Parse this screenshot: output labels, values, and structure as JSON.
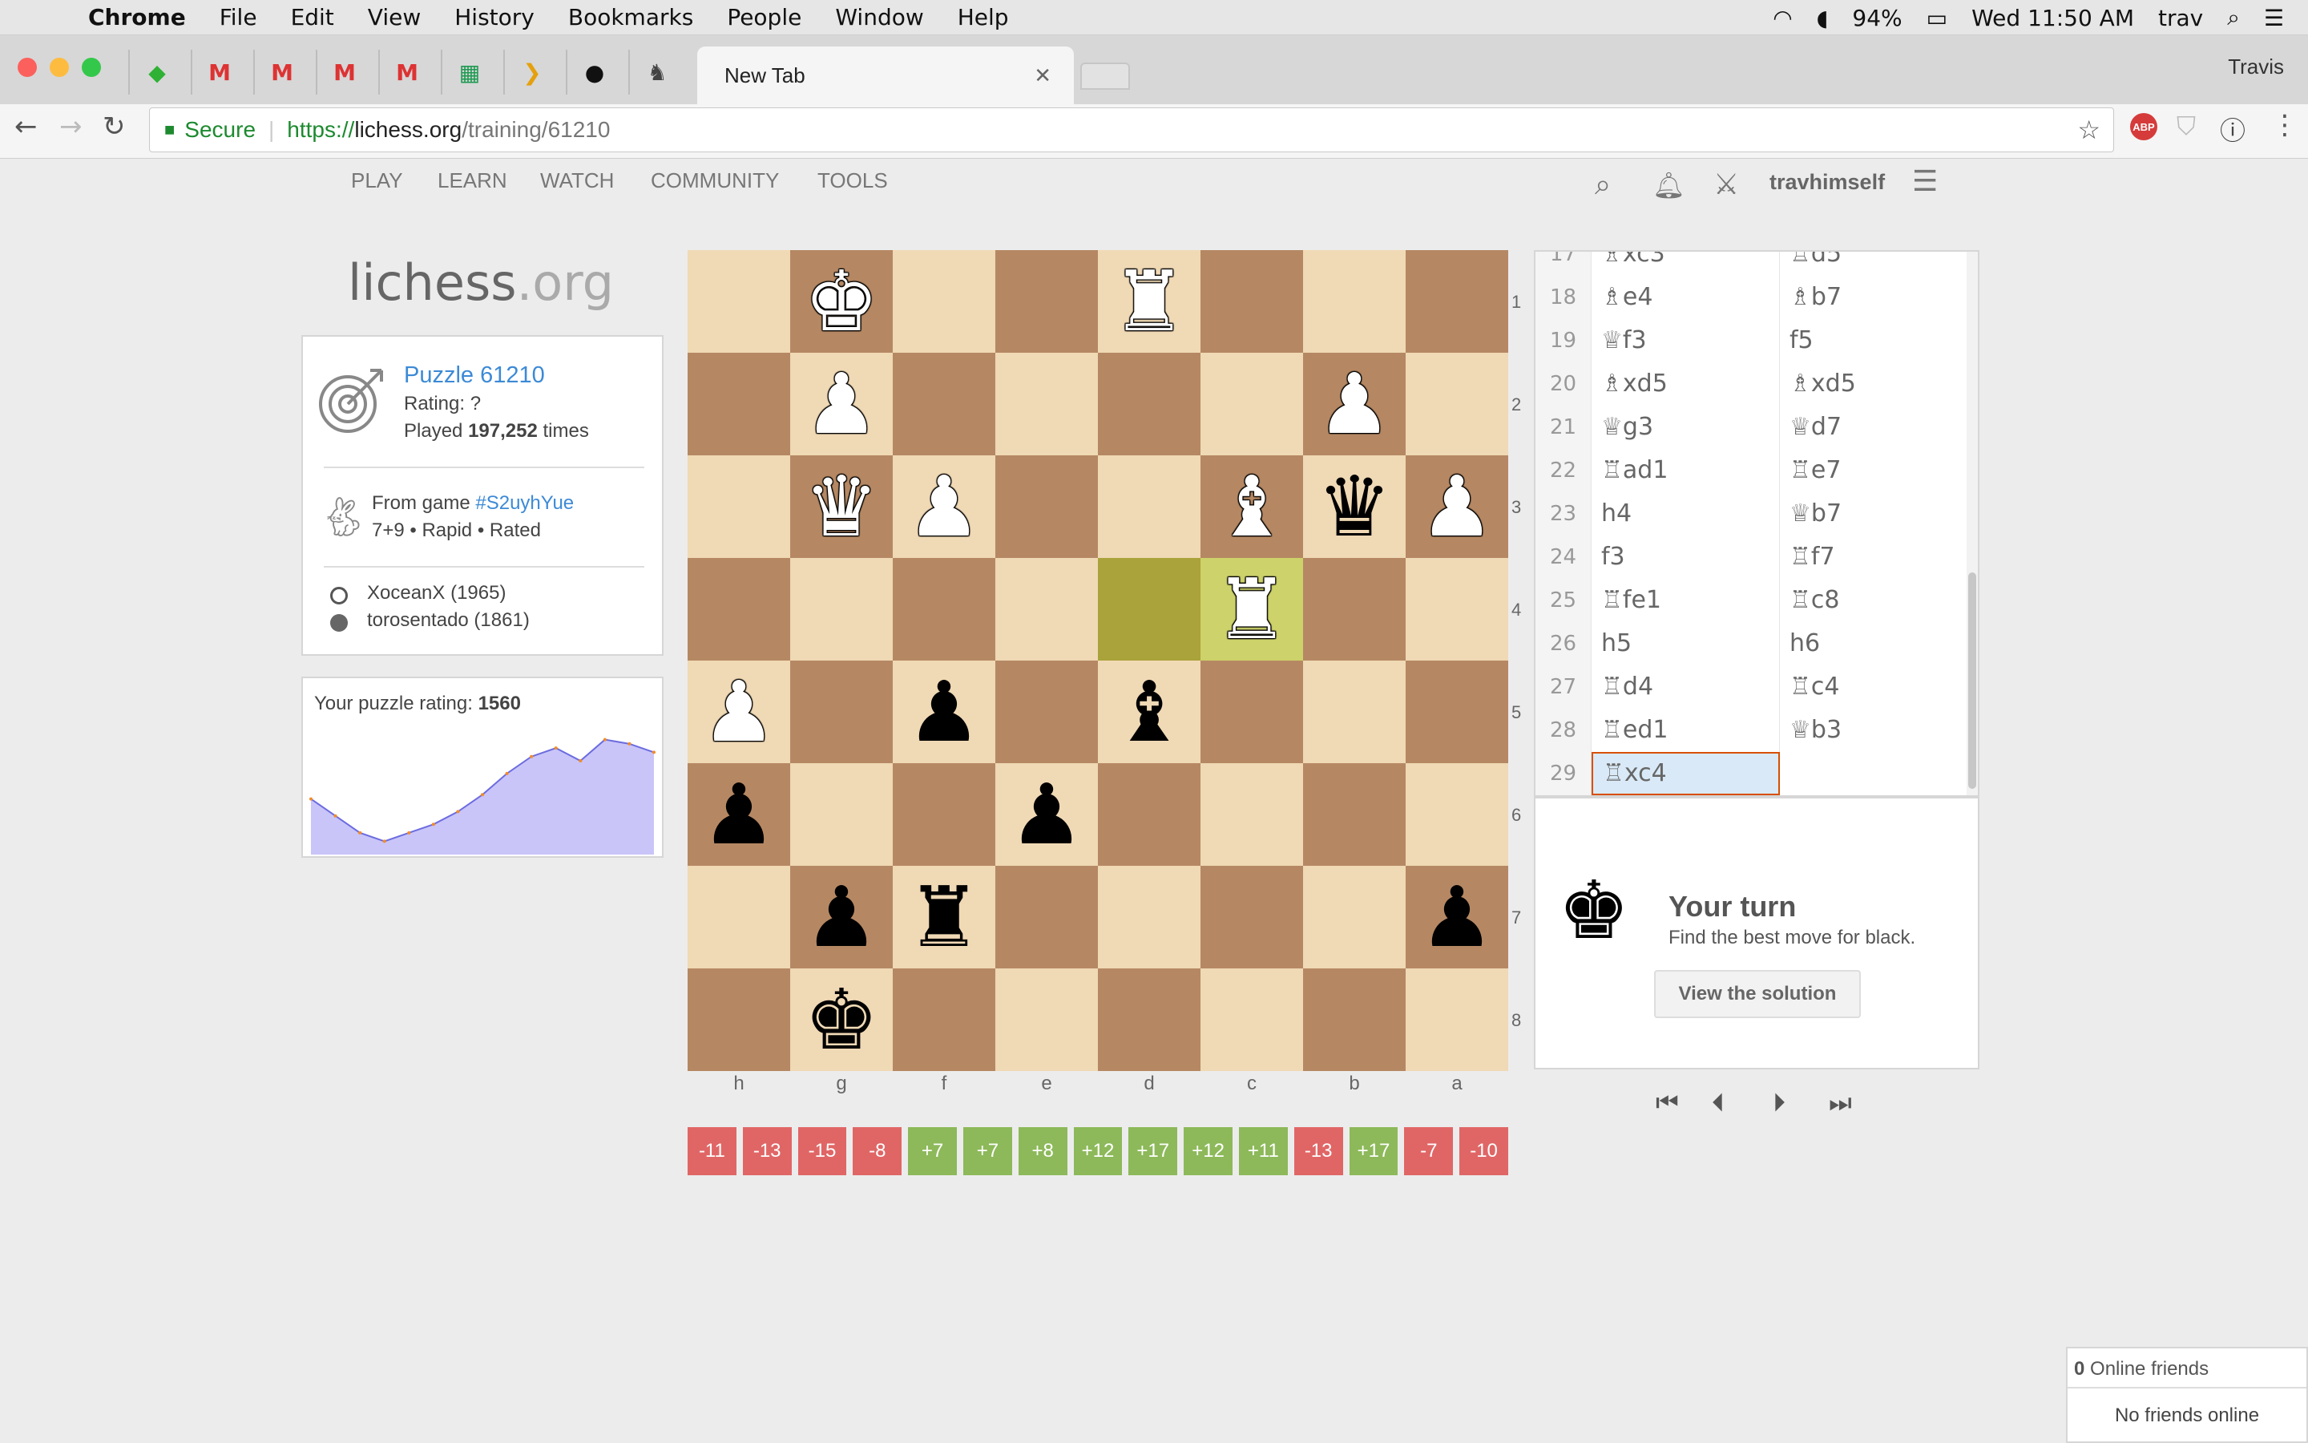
{
  "menubar": {
    "app": "Chrome",
    "items": [
      "File",
      "Edit",
      "View",
      "History",
      "Bookmarks",
      "People",
      "Window",
      "Help"
    ],
    "battery": "94%",
    "clock": "Wed 11:50 AM",
    "user": "trav"
  },
  "browser": {
    "tab_title": "New Tab",
    "profile": "Travis",
    "secure_label": "Secure",
    "url_prefix": "https://",
    "url_host": "lichess.org",
    "url_path": "/training/61210"
  },
  "sitenav": {
    "items": [
      "PLAY",
      "LEARN",
      "WATCH",
      "COMMUNITY",
      "TOOLS"
    ],
    "username": "travhimself"
  },
  "logo": {
    "main": "lichess",
    "tld": ".org"
  },
  "puzzle": {
    "title": "Puzzle 61210",
    "rating_label": "Rating: ",
    "rating_value": "?",
    "played_prefix": "Played ",
    "played_count": "197,252",
    "played_suffix": " times",
    "game_prefix": "From game ",
    "game_id": "#S2uyhYue",
    "game_info": "7+9 • Rapid • Rated",
    "player_white": "XoceanX (1965)",
    "player_black": "torosentado (1861)"
  },
  "rating_panel": {
    "label": "Your puzzle rating: ",
    "value": "1560",
    "series": [
      1540,
      1520,
      1500,
      1490,
      1500,
      1510,
      1525,
      1545,
      1570,
      1590,
      1600,
      1585,
      1610,
      1605,
      1595
    ]
  },
  "board": {
    "ranks": [
      "1",
      "2",
      "3",
      "4",
      "5",
      "6",
      "7",
      "8"
    ],
    "files": [
      "h",
      "g",
      "f",
      "e",
      "d",
      "c",
      "b",
      "a"
    ],
    "rows": [
      [
        null,
        {
          "p": "k",
          "c": "w"
        },
        null,
        null,
        {
          "p": "r",
          "c": "w"
        },
        null,
        null,
        null
      ],
      [
        null,
        {
          "p": "p",
          "c": "w"
        },
        null,
        null,
        null,
        null,
        {
          "p": "p",
          "c": "w"
        },
        null
      ],
      [
        null,
        {
          "p": "q",
          "c": "w"
        },
        {
          "p": "p",
          "c": "w"
        },
        null,
        null,
        {
          "p": "b",
          "c": "w"
        },
        {
          "p": "q",
          "c": "b"
        },
        {
          "p": "p",
          "c": "w"
        }
      ],
      [
        null,
        null,
        null,
        null,
        null,
        {
          "p": "r",
          "c": "w"
        },
        null,
        null
      ],
      [
        {
          "p": "p",
          "c": "w"
        },
        null,
        {
          "p": "p",
          "c": "b"
        },
        null,
        {
          "p": "b",
          "c": "b"
        },
        null,
        null,
        null
      ],
      [
        {
          "p": "p",
          "c": "b"
        },
        null,
        null,
        {
          "p": "p",
          "c": "b"
        },
        null,
        null,
        null,
        null
      ],
      [
        null,
        {
          "p": "p",
          "c": "b"
        },
        {
          "p": "r",
          "c": "b"
        },
        null,
        null,
        null,
        null,
        {
          "p": "p",
          "c": "b"
        }
      ],
      [
        null,
        {
          "p": "k",
          "c": "b"
        },
        null,
        null,
        null,
        null,
        null,
        null
      ]
    ],
    "highlights": [
      [
        3,
        4
      ],
      [
        3,
        5
      ]
    ]
  },
  "evals": [
    {
      "v": "-11",
      "s": "neg"
    },
    {
      "v": "-13",
      "s": "neg"
    },
    {
      "v": "-15",
      "s": "neg"
    },
    {
      "v": "-8",
      "s": "neg"
    },
    {
      "v": "+7",
      "s": "pos"
    },
    {
      "v": "+7",
      "s": "pos"
    },
    {
      "v": "+8",
      "s": "pos"
    },
    {
      "v": "+12",
      "s": "pos"
    },
    {
      "v": "+17",
      "s": "pos"
    },
    {
      "v": "+12",
      "s": "pos"
    },
    {
      "v": "+11",
      "s": "pos"
    },
    {
      "v": "-13",
      "s": "neg"
    },
    {
      "v": "+17",
      "s": "pos"
    },
    {
      "v": "-7",
      "s": "neg"
    },
    {
      "v": "-10",
      "s": "neg"
    }
  ],
  "moves": [
    {
      "n": "17",
      "w": "♗xc3",
      "b": "♖d5"
    },
    {
      "n": "18",
      "w": "♗e4",
      "b": "♗b7"
    },
    {
      "n": "19",
      "w": "♕f3",
      "b": "f5"
    },
    {
      "n": "20",
      "w": "♗xd5",
      "b": "♗xd5"
    },
    {
      "n": "21",
      "w": "♕g3",
      "b": "♕d7"
    },
    {
      "n": "22",
      "w": "♖ad1",
      "b": "♖e7"
    },
    {
      "n": "23",
      "w": "h4",
      "b": "♕b7"
    },
    {
      "n": "24",
      "w": "f3",
      "b": "♖f7"
    },
    {
      "n": "25",
      "w": "♖fe1",
      "b": "♖c8"
    },
    {
      "n": "26",
      "w": "h5",
      "b": "h6"
    },
    {
      "n": "27",
      "w": "♖d4",
      "b": "♖c4"
    },
    {
      "n": "28",
      "w": "♖ed1",
      "b": "♕b3"
    },
    {
      "n": "29",
      "w": "♖xc4",
      "b": ""
    }
  ],
  "turn": {
    "title": "Your turn",
    "subtitle": "Find the best move for black.",
    "button": "View the solution"
  },
  "friends": {
    "count": "0",
    "label": " Online friends",
    "empty": "No friends online"
  },
  "colors": {
    "neg": "#e06666",
    "pos": "#8db95a",
    "light_square": "#f0d9b5",
    "dark_square": "#b58863",
    "link": "#3c8ad6"
  }
}
